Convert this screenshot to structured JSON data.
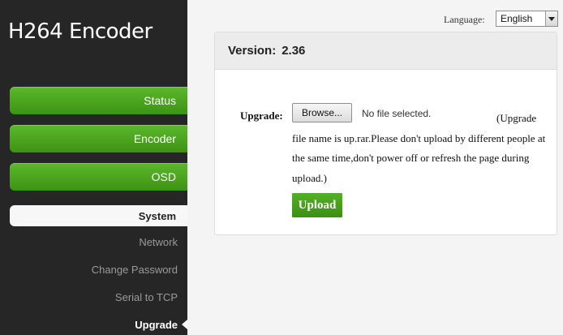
{
  "app": {
    "title": "H264 Encoder"
  },
  "nav": {
    "status": "Status",
    "encoder": "Encoder",
    "osd": "OSD",
    "system": "System",
    "network": "Network",
    "change_password": "Change Password",
    "serial_to_tcp": "Serial to TCP",
    "upgrade": "Upgrade"
  },
  "language": {
    "label": "Language:",
    "selected": "English"
  },
  "card": {
    "version_label": "Version:",
    "version_value": "2.36",
    "upgrade_label": "Upgrade:",
    "browse_label": "Browse...",
    "file_status": "No file selected.",
    "note": "(Upgrade file name is up.rar.Please don't upload by different people at the same time,don't power off or refresh the page during upload.)",
    "upload_label": "Upload"
  },
  "colors": {
    "sidebar_bg": "#262626",
    "accent_green": "#4ca41d",
    "card_header_bg": "#ececec"
  }
}
